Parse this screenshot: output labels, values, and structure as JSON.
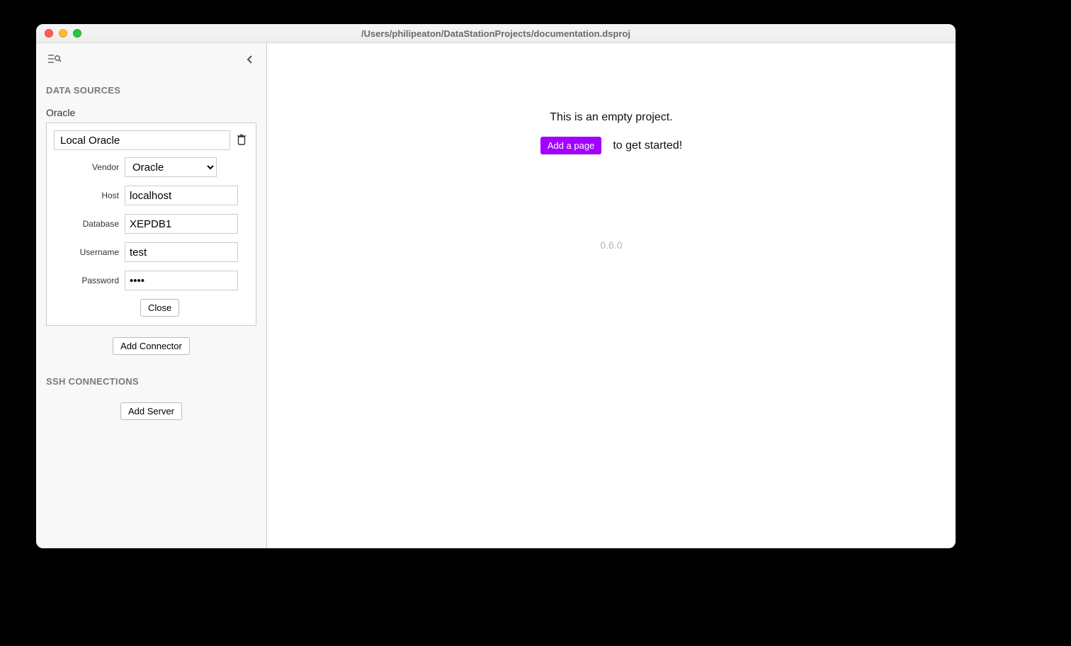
{
  "window": {
    "title": "/Users/philipeaton/DataStationProjects/documentation.dsproj"
  },
  "sidebar": {
    "dataSourcesHeader": "DATA SOURCES",
    "connector": {
      "type": "Oracle",
      "name": "Local Oracle",
      "vendorLabel": "Vendor",
      "vendorValue": "Oracle",
      "hostLabel": "Host",
      "hostValue": "localhost",
      "databaseLabel": "Database",
      "databaseValue": "XEPDB1",
      "usernameLabel": "Username",
      "usernameValue": "test",
      "passwordLabel": "Password",
      "passwordValue": "••••",
      "closeLabel": "Close"
    },
    "addConnectorLabel": "Add Connector",
    "sshHeader": "SSH CONNECTIONS",
    "addServerLabel": "Add Server"
  },
  "main": {
    "emptyMessage": "This is an empty project.",
    "addPageLabel": "Add a page",
    "getStarted": "to get started!",
    "version": "0.6.0"
  }
}
